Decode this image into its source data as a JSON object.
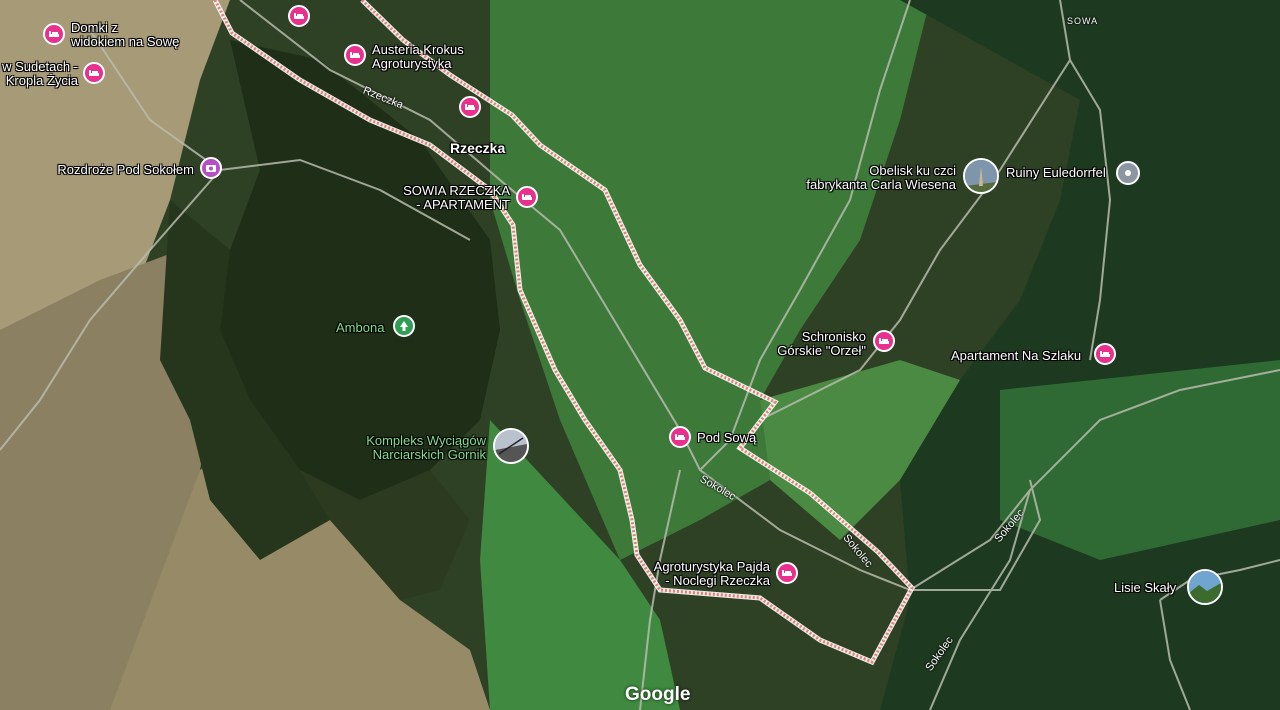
{
  "map": {
    "places": [
      {
        "id": "domki",
        "text": [
          "Domki z",
          "widokiem na Sowę"
        ],
        "icon": "hotel-icon"
      },
      {
        "id": "sudetach",
        "text": [
          "w Sudetach -",
          "Kropla Życia"
        ],
        "icon": "hotel-icon"
      },
      {
        "id": "austeria",
        "text": [
          "Austeria Krokus",
          "Agroturystyka"
        ],
        "icon": "hotel-icon"
      },
      {
        "id": "rozdroze",
        "text": [
          "Rozdroże Pod Sokołem"
        ],
        "icon": "camera-icon"
      },
      {
        "id": "sowia",
        "text": [
          "SOWIA RZECZKA",
          "- APARTAMENT"
        ],
        "icon": "hotel-icon"
      },
      {
        "id": "obelisk",
        "text": [
          "Obelisk ku czci",
          "fabrykanta Carla Wiesena"
        ],
        "icon": "photo-icon"
      },
      {
        "id": "ruiny",
        "text": [
          "Ruiny Euledorrfel"
        ],
        "icon": "place-icon"
      },
      {
        "id": "ambona",
        "text": [
          "Ambona"
        ],
        "icon": "tree-icon"
      },
      {
        "id": "schronisko",
        "text": [
          "Schronisko",
          "Górskie \"Orzeł\""
        ],
        "icon": "hotel-icon"
      },
      {
        "id": "apartament",
        "text": [
          "Apartament Na Szlaku"
        ],
        "icon": "hotel-icon"
      },
      {
        "id": "kompleks",
        "text": [
          "Kompleks Wyciągów",
          "Narciarskich Gornik"
        ],
        "icon": "photo-icon"
      },
      {
        "id": "podsowa",
        "text": [
          "Pod Sową"
        ],
        "icon": "hotel-icon"
      },
      {
        "id": "pajda",
        "text": [
          "Agroturystyka Pajda",
          "- Noclegi Rzeczka"
        ],
        "icon": "hotel-icon"
      },
      {
        "id": "lisie",
        "text": [
          "Lisie Skały"
        ],
        "icon": "photo-icon"
      }
    ],
    "town": "Rzeczka",
    "roads": {
      "rzeczka": "Rzeczka",
      "sokolec1": "Sokolec",
      "sokolec2": "Sokolec",
      "sokolec3": "Sokolec",
      "sokolec4": "Sokolec"
    },
    "area_label": "SOWA",
    "logo": "Google",
    "colors": {
      "boundary": "#f4a6a0",
      "hotel_pin": "#e8308c",
      "place_pin": "#8c96a0",
      "tree_pin": "#2f9d55"
    }
  }
}
